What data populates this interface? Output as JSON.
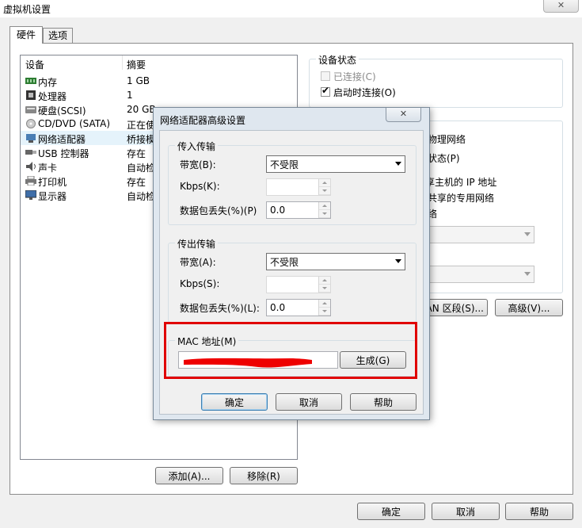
{
  "window": {
    "title": "虚拟机设置"
  },
  "tabs": [
    {
      "label": "硬件"
    },
    {
      "label": "选项"
    }
  ],
  "devices": {
    "header": {
      "device": "设备",
      "summary": "摘要"
    },
    "rows": [
      {
        "name": "内存",
        "summary": "1 GB",
        "icon": "memory-icon"
      },
      {
        "name": "处理器",
        "summary": "1",
        "icon": "processor-icon"
      },
      {
        "name": "硬盘(SCSI)",
        "summary": "20 GB",
        "icon": "harddisk-icon"
      },
      {
        "name": "CD/DVD (SATA)",
        "summary": "正在使",
        "icon": "cd-dvd-icon"
      },
      {
        "name": "网络适配器",
        "summary": "桥接模",
        "icon": "network-adapter-icon"
      },
      {
        "name": "USB 控制器",
        "summary": "存在",
        "icon": "usb-icon"
      },
      {
        "name": "声卡",
        "summary": "自动检",
        "icon": "sound-card-icon"
      },
      {
        "name": "打印机",
        "summary": "存在",
        "icon": "printer-icon"
      },
      {
        "name": "显示器",
        "summary": "自动检",
        "icon": "display-icon"
      }
    ]
  },
  "left_buttons": {
    "add": "添加(A)...",
    "remove": "移除(R)"
  },
  "device_status": {
    "title": "设备状态",
    "connected": "已连接(C)",
    "connect_on_start": "启动时连接(O)"
  },
  "network_partial": {
    "physical": "物理网络",
    "state": "状态(P)",
    "host_ip": "享主机的 IP 地址",
    "shared_private": "共享的专用网络",
    "network": "络",
    "lan_segments": "AN 区段(S)...",
    "advanced": "高级(V)..."
  },
  "bottom_buttons": {
    "ok": "确定",
    "cancel": "取消",
    "help": "帮助"
  },
  "dialog": {
    "title": "网络适配器高级设置",
    "incoming": {
      "title": "传入传输",
      "bandwidth_label": "带宽(B):",
      "bandwidth_value": "不受限",
      "kbps_label": "Kbps(K):",
      "kbps_value": "",
      "loss_label": "数据包丢失(%)(P)",
      "loss_value": "0.0"
    },
    "outgoing": {
      "title": "传出传输",
      "bandwidth_label": "带宽(A):",
      "bandwidth_value": "不受限",
      "kbps_label": "Kbps(S):",
      "kbps_value": "",
      "loss_label": "数据包丢失(%)(L):",
      "loss_value": "0.0"
    },
    "mac": {
      "title": "MAC 地址(M)",
      "value": "",
      "generate": "生成(G)"
    },
    "ok": "确定",
    "cancel": "取消",
    "help": "帮助"
  },
  "colors": {
    "highlight_border": "#e00000",
    "redaction": "#ee0000",
    "default_button_border": "#3c7fb1"
  }
}
